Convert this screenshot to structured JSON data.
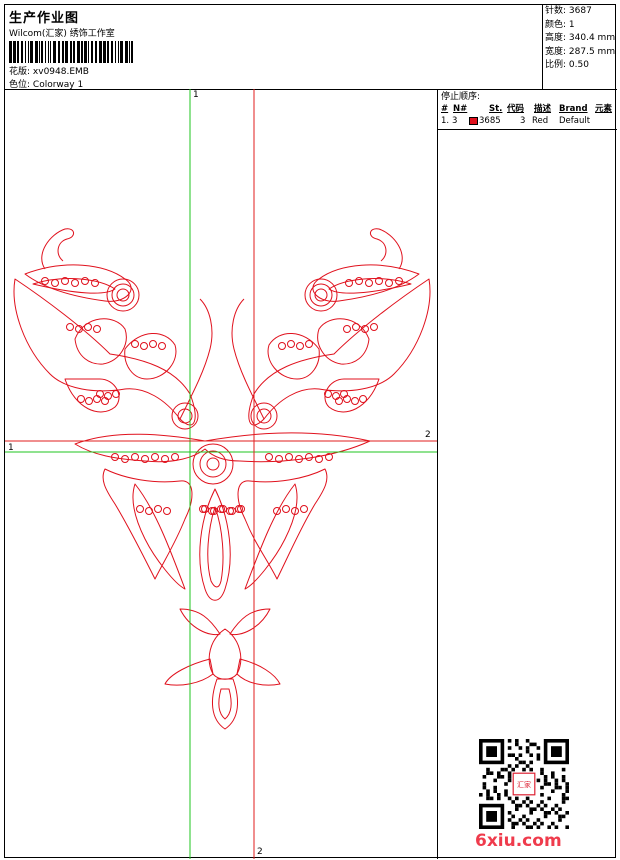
{
  "header": {
    "title": "生产作业图",
    "company": "Wilcom(汇家) 绣饰工作室",
    "design_label": "花版:",
    "design_value": "xv0948.EMB",
    "colorway_label": "色位:",
    "colorway_value": "Colorway 1"
  },
  "stats": {
    "stitches_label": "针数:",
    "stitches": "3687",
    "colors_label": "颜色:",
    "colors": "1",
    "height_label": "高度:",
    "height": "340.4 mm",
    "width_label": "宽度:",
    "width": "287.5 mm",
    "scale_label": "比例:",
    "scale": "0.50"
  },
  "stop_sequence": {
    "title": "停止顺序:",
    "columns": [
      "#",
      "N#",
      "St.",
      "代码",
      "描述",
      "Brand",
      "元素"
    ],
    "rows": [
      {
        "num": "1.",
        "needle": "3",
        "stitches": "3685",
        "code": "3",
        "desc": "Red",
        "brand": "Default",
        "color": "#e0111d"
      }
    ]
  },
  "guides": {
    "green_top": "1",
    "green_left": "1",
    "red_right": "2",
    "red_bottom": "2"
  },
  "colors": {
    "thread": "#e0111d",
    "guide_green": "#1fc41f",
    "guide_red": "#e01d1d"
  },
  "watermark": "6xiu.com",
  "qr_seal": "汇家"
}
